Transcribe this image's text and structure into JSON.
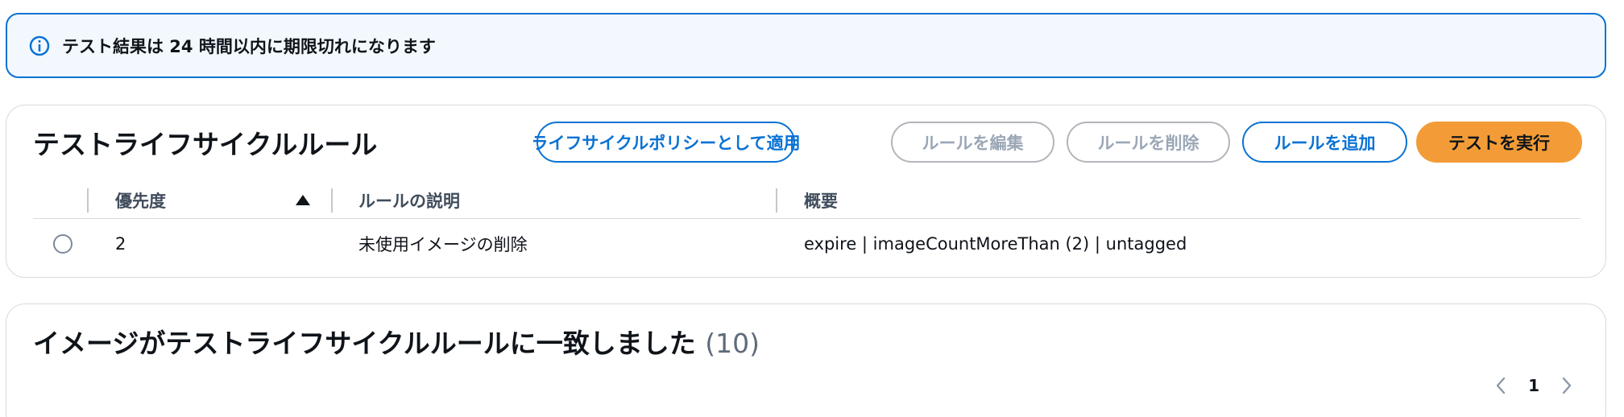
{
  "alert": {
    "icon": "info-icon",
    "text": "テスト結果は 24 時間以内に期限切れになります"
  },
  "rules_panel": {
    "title": "テストライフサイクルルール",
    "buttons": {
      "apply_policy": "ライフサイクルポリシーとして適用",
      "edit_rule": "ルールを編集",
      "delete_rule": "ルールを削除",
      "add_rule": "ルールを追加",
      "run_test": "テストを実行"
    },
    "table": {
      "columns": [
        "優先度",
        "ルールの説明",
        "概要"
      ],
      "sort_column": "優先度",
      "sort_direction": "ascending",
      "rows": [
        {
          "priority": "2",
          "description": "未使用イメージの削除",
          "summary": "expire | imageCountMoreThan (2) | untagged",
          "selected": false
        }
      ]
    }
  },
  "matched_panel": {
    "title": "イメージがテストライフサイクルルールに一致しました",
    "count": "(10)",
    "pagination": {
      "current_page": "1"
    }
  },
  "colors": {
    "accent": "#0972d3",
    "primary_button": "#f39c37",
    "alert_background": "#f2f8fd"
  }
}
